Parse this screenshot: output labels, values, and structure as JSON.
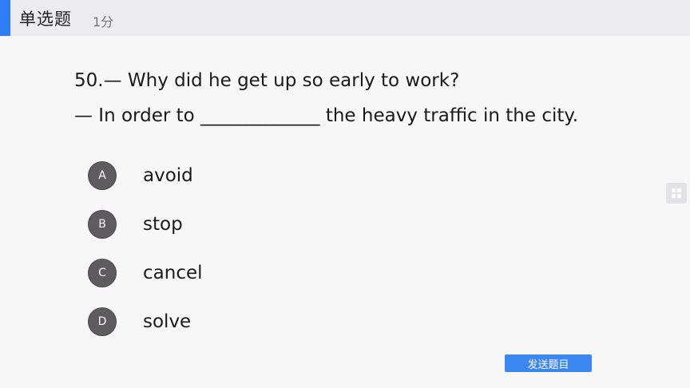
{
  "header": {
    "question_type": "单选题",
    "score": "1分"
  },
  "question": {
    "line1": "50.— Why did he get up so early to work?",
    "line2": "— In order to _____________ the heavy traffic in the city."
  },
  "options": [
    {
      "letter": "A",
      "text": "avoid"
    },
    {
      "letter": "B",
      "text": "stop"
    },
    {
      "letter": "C",
      "text": "cancel"
    },
    {
      "letter": "D",
      "text": "solve"
    }
  ],
  "actions": {
    "send_label": "发送题目"
  },
  "side_panel": {
    "icon": "grid-icon"
  },
  "colors": {
    "accent": "#2f7cf6",
    "option_circle": "#5e5c5f",
    "button": "#3c86f0"
  }
}
